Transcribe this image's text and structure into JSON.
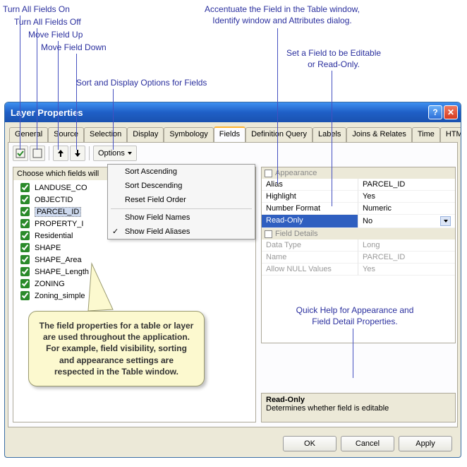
{
  "annotations": {
    "turn_on": "Turn All Fields On",
    "turn_off": "Turn All Fields Off",
    "move_up": "Move Field Up",
    "move_down": "Move Field Down",
    "sort_opts": "Sort and Display Options for Fields",
    "accentuate": "Accentuate the Field in the Table window,\nIdentify window and Attributes dialog.",
    "editable": "Set a Field to be Editable\nor Read-Only.",
    "quickhelp": "Quick Help for Appearance and\nField Detail Properties."
  },
  "window": {
    "title": "Layer Properties"
  },
  "tabs": [
    "General",
    "Source",
    "Selection",
    "Display",
    "Symbology",
    "Fields",
    "Definition Query",
    "Labels",
    "Joins & Relates",
    "Time",
    "HTML Popup"
  ],
  "active_tab": "Fields",
  "toolbar": {
    "options_label": "Options"
  },
  "left_header": "Choose which fields will",
  "fields": [
    "LANDUSE_CO",
    "OBJECTID",
    "PARCEL_ID",
    "PROPERTY_I",
    "Residential",
    "SHAPE",
    "SHAPE_Area",
    "SHAPE_Length",
    "ZONING",
    "Zoning_simple"
  ],
  "selected_field": "PARCEL_ID",
  "dropdown": {
    "items": [
      "Sort Ascending",
      "Sort Descending",
      "Reset Field Order",
      "Show Field Names",
      "Show Field Aliases"
    ],
    "checked": "Show Field Aliases"
  },
  "appearance_label": "Appearance",
  "details_label": "Field Details",
  "props_appearance": [
    {
      "k": "Alias",
      "v": "PARCEL_ID"
    },
    {
      "k": "Highlight",
      "v": "Yes"
    },
    {
      "k": "Number Format",
      "v": "Numeric"
    },
    {
      "k": "Read-Only",
      "v": "No",
      "sel": true
    }
  ],
  "props_details": [
    {
      "k": "Data Type",
      "v": "Long"
    },
    {
      "k": "Name",
      "v": "PARCEL_ID"
    },
    {
      "k": "Allow NULL Values",
      "v": "Yes"
    }
  ],
  "help": {
    "title": "Read-Only",
    "body": "Determines whether field is editable"
  },
  "buttons": {
    "ok": "OK",
    "cancel": "Cancel",
    "apply": "Apply"
  },
  "callout": "The field properties for a table or layer are used throughout the application.  For example, field visibility, sorting and appearance settings are respected in the Table window."
}
